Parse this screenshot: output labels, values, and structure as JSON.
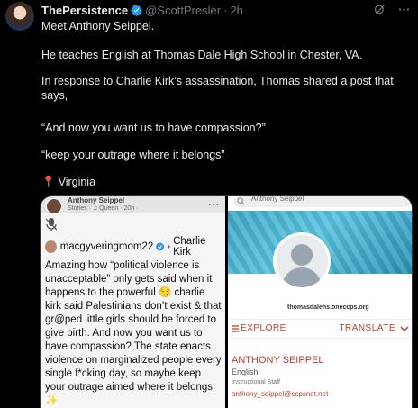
{
  "tweet": {
    "display_name": "ThePersistence",
    "handle": "@ScottPresler",
    "separator": "·",
    "time": "2h",
    "paragraphs": [
      "Meet Anthony Seippel.",
      "He teaches English at Thomas Dale High School in Chester, VA.",
      "In response to Charlie Kirk’s assassination, Thomas shared a post that says,",
      "“And now you want us to have compassion?”",
      "“keep your outrage where it belongs”",
      "Virginia"
    ],
    "pin_icon": "📍"
  },
  "left_image": {
    "story_name": "Anthony Seippel",
    "story_meta": "Stories · ♫ Queen · 20h ·",
    "story_dots": "···",
    "post_user": "macgyveringmom22",
    "post_target": "Charlie Kirk",
    "post_arrow": "›",
    "post_body": "Amazing how “political violence is unacceptable” only gets said when it happens to the powerful 😏 charlie kirk said Palestinians don’t exist & that gr@ped little girls should be forced to give birth. And now you want us to have compassion? The state enacts violence on marginalized people every single f*cking day, so maybe keep your outrage aimed where it belongs ✨"
  },
  "right_image": {
    "search_text": "Anthony Seippel",
    "domain": "thomasdalehs.oneccps.org",
    "explore_label": "EXPLORE",
    "translate_label": "TRANSLATE",
    "staff_name": "ANTHONY SEIPPEL",
    "staff_dept": "English",
    "staff_role": "Instructional Staff",
    "staff_email": "anthony_seippel@ccpsnet.net"
  },
  "colors": {
    "verified": "#1d9bf0",
    "accent_red": "#c0392b",
    "muted": "#71767b"
  }
}
